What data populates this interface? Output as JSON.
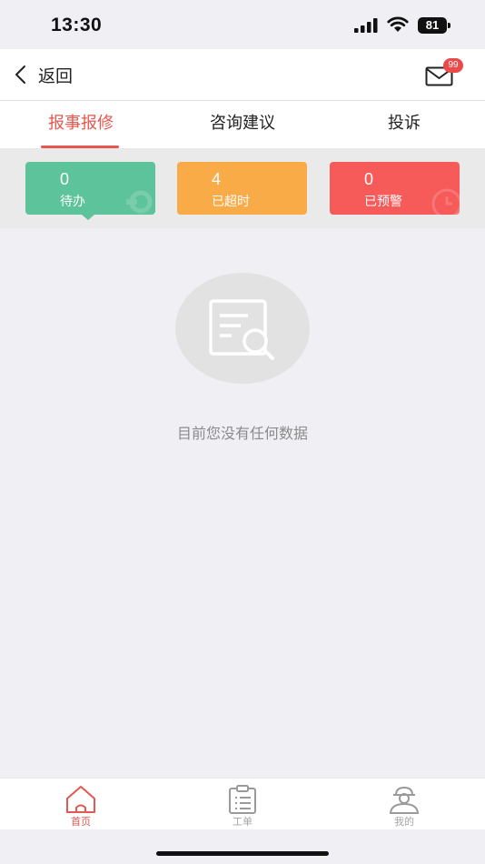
{
  "status_bar": {
    "time": "13:30",
    "battery": "81",
    "icons": [
      "signal-icon",
      "wifi-icon",
      "battery-icon"
    ]
  },
  "header": {
    "back_label": "返回",
    "mail_badge": "99",
    "icons": [
      "chevron-left-icon",
      "mail-icon"
    ]
  },
  "tabs": [
    {
      "label": "报事报修",
      "active": true
    },
    {
      "label": "咨询建议",
      "active": false
    },
    {
      "label": "投诉",
      "active": false
    }
  ],
  "stats": [
    {
      "value": "0",
      "label": "待办",
      "color": "#5dc39a"
    },
    {
      "value": "4",
      "label": "已超时",
      "color": "#f9ab48"
    },
    {
      "value": "0",
      "label": "已预警",
      "color": "#f65a59"
    }
  ],
  "empty_state": {
    "text": "目前您没有任何数据",
    "icon": "document-search-icon"
  },
  "bottom_nav": [
    {
      "label": "首页",
      "icon": "home-icon",
      "active": true
    },
    {
      "label": "工单",
      "icon": "clipboard-icon",
      "active": false
    },
    {
      "label": "我的",
      "icon": "worker-profile-icon",
      "active": false
    }
  ],
  "colors": {
    "accent": "#e5574f",
    "background": "#efeff4",
    "badge": "#ea4a4a"
  }
}
